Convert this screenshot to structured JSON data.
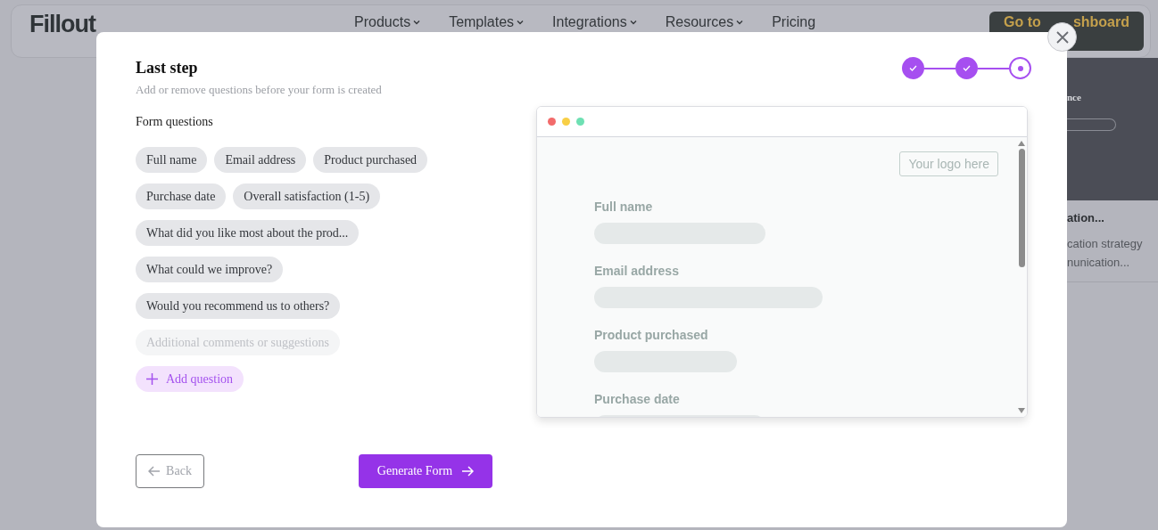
{
  "header": {
    "logo": "Fillout",
    "nav": [
      {
        "label": "Products",
        "caret": true
      },
      {
        "label": "Templates",
        "caret": true
      },
      {
        "label": "Integrations",
        "caret": true
      },
      {
        "label": "Resources",
        "caret": true
      },
      {
        "label": "Pricing",
        "caret": false
      }
    ],
    "cta_parts": [
      "Go to",
      "shboard"
    ]
  },
  "background_card": {
    "overline": "nce",
    "title": "ation...",
    "lines": [
      "cation strategy",
      "nunication..."
    ]
  },
  "modal": {
    "title": "Last step",
    "subtitle": "Add or remove questions before your form is created",
    "steps": [
      {
        "done": true
      },
      {
        "done": true
      },
      {
        "done": false
      }
    ],
    "questions_label": "Form questions",
    "questions": [
      {
        "label": "Full name",
        "disabled": false
      },
      {
        "label": "Email address",
        "disabled": false
      },
      {
        "label": "Product purchased",
        "disabled": false
      },
      {
        "label": "Purchase date",
        "disabled": false
      },
      {
        "label": "Overall satisfaction (1-5)",
        "disabled": false
      },
      {
        "label": "What did you like most about the prod...",
        "disabled": false
      },
      {
        "label": "What could we improve?",
        "disabled": false
      },
      {
        "label": "Would you recommend us to others?",
        "disabled": false
      },
      {
        "label": "Additional comments or suggestions",
        "disabled": true
      }
    ],
    "add_button": "Add question",
    "preview": {
      "logo_placeholder": "Your logo here",
      "fields": [
        {
          "label": "Full name"
        },
        {
          "label": "Email address"
        },
        {
          "label": "Product purchased"
        },
        {
          "label": "Purchase date"
        }
      ]
    },
    "back_button": "Back",
    "generate_button": "Generate Form"
  }
}
